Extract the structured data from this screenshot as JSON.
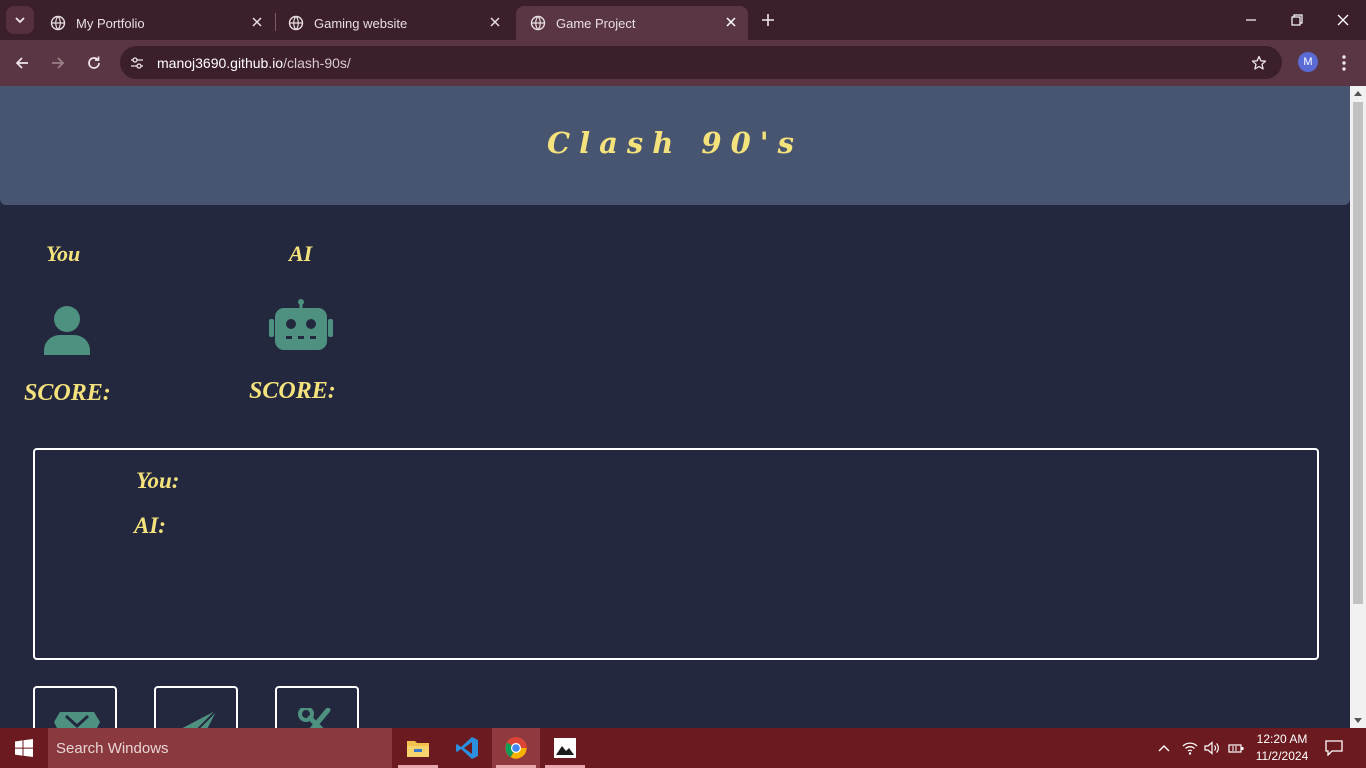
{
  "browser": {
    "tabs": [
      {
        "title": "My Portfolio",
        "active": false
      },
      {
        "title": "Gaming website",
        "active": false
      },
      {
        "title": "Game Project",
        "active": true
      }
    ],
    "url_host": "manoj3690.github.io",
    "url_path": "/clash-90s/",
    "profile_initial": "M"
  },
  "page": {
    "title": "Clash 90's",
    "you_label": "You",
    "ai_label": "AI",
    "you_score_label": "SCORE:",
    "ai_score_label": "SCORE:",
    "result_you_label": "You:",
    "result_ai_label": "AI:",
    "choices": [
      {
        "icon": "rock-icon"
      },
      {
        "icon": "paper-icon"
      },
      {
        "icon": "scissors-icon"
      }
    ],
    "colors": {
      "background": "#24283f",
      "header": "#485570",
      "accent_text": "#f4e27c",
      "icon": "#4f9181"
    }
  },
  "taskbar": {
    "search_placeholder": "Search Windows",
    "time": "12:20 AM",
    "date": "11/2/2024"
  }
}
